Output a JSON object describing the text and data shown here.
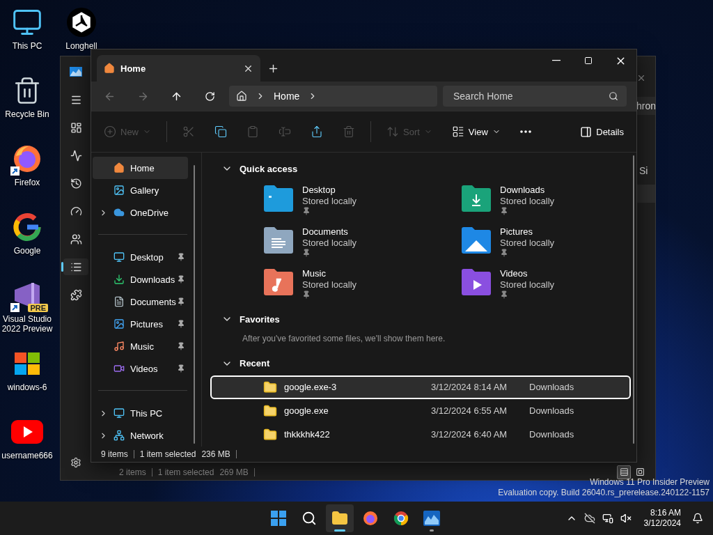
{
  "desktop_icons": [
    {
      "label": "This PC",
      "kind": "pc"
    },
    {
      "label": "Recycle Bin",
      "kind": "bin"
    },
    {
      "label": "Firefox",
      "kind": "firefox",
      "shortcut": true
    },
    {
      "label": "Google",
      "kind": "google"
    },
    {
      "label": "Visual Studio 2022 Preview",
      "kind": "vs",
      "shortcut": true,
      "badge": "PRE"
    },
    {
      "label": "windows-6",
      "kind": "windows"
    },
    {
      "label": "username666",
      "kind": "youtube"
    }
  ],
  "desktop_icons_column_2": [
    {
      "label": "Longhell",
      "kind": "unity"
    }
  ],
  "back_window": {
    "nav": [
      {
        "kind": "logo",
        "selected": false
      },
      {
        "kind": "menu",
        "selected": false
      },
      {
        "kind": "dashboard",
        "selected": false
      },
      {
        "kind": "pulse",
        "selected": false
      },
      {
        "kind": "history",
        "selected": false
      },
      {
        "kind": "gauge",
        "selected": false
      },
      {
        "kind": "people",
        "selected": false
      },
      {
        "kind": "list",
        "selected": true
      },
      {
        "kind": "puzzle",
        "selected": false
      }
    ],
    "title_fragment": "hron",
    "column_fragment": "Si",
    "status_bar": {
      "item_count": "2 items",
      "selection": "1 item selected",
      "size": "269 MB"
    },
    "view_buttons": [
      {
        "kind": "details",
        "selected": true
      },
      {
        "kind": "tiles",
        "selected": false
      }
    ]
  },
  "window": {
    "tabs": [
      {
        "label": "Home",
        "selected": true
      }
    ],
    "address": {
      "crumbs": [
        "Home"
      ]
    },
    "search": {
      "placeholder": "Search Home"
    },
    "toolbar": [
      {
        "kind": "new",
        "label": "New",
        "disabled": true,
        "dropdown": true
      },
      {
        "kind": "cut",
        "disabled": true
      },
      {
        "kind": "copy",
        "disabled": false
      },
      {
        "kind": "paste",
        "disabled": true
      },
      {
        "kind": "rename",
        "disabled": true
      },
      {
        "kind": "share",
        "disabled": false
      },
      {
        "kind": "delete",
        "disabled": true
      },
      {
        "kind": "sort",
        "label": "Sort",
        "disabled": true,
        "dropdown": true
      },
      {
        "kind": "view",
        "label": "View",
        "disabled": false,
        "dropdown": true
      },
      {
        "kind": "more",
        "disabled": false
      }
    ],
    "details_button": {
      "label": "Details"
    },
    "sidebar": {
      "groups": [
        [
          {
            "label": "Home",
            "kind": "home",
            "selected": true,
            "pinned": false,
            "expandable": false
          },
          {
            "label": "Gallery",
            "kind": "gallery",
            "selected": false,
            "pinned": false,
            "expandable": false
          },
          {
            "label": "OneDrive",
            "kind": "cloud",
            "selected": false,
            "pinned": false,
            "expandable": true
          }
        ],
        [
          {
            "label": "Desktop",
            "kind": "desktop",
            "selected": false,
            "pinned": true,
            "expandable": false
          },
          {
            "label": "Downloads",
            "kind": "downloads",
            "selected": false,
            "pinned": true,
            "expandable": false
          },
          {
            "label": "Documents",
            "kind": "documents",
            "selected": false,
            "pinned": true,
            "expandable": false
          },
          {
            "label": "Pictures",
            "kind": "pictures",
            "selected": false,
            "pinned": true,
            "expandable": false
          },
          {
            "label": "Music",
            "kind": "music",
            "selected": false,
            "pinned": true,
            "expandable": false
          },
          {
            "label": "Videos",
            "kind": "videos",
            "selected": false,
            "pinned": true,
            "expandable": false
          }
        ],
        [
          {
            "label": "This PC",
            "kind": "pc",
            "selected": false,
            "pinned": false,
            "expandable": true
          },
          {
            "label": "Network",
            "kind": "network",
            "selected": false,
            "pinned": false,
            "expandable": true
          }
        ]
      ]
    },
    "quick_access": {
      "title": "Quick access",
      "expanded": true,
      "folders": [
        {
          "name": "Desktop",
          "status": "Stored locally",
          "kind": "desktop",
          "pinned": true
        },
        {
          "name": "Downloads",
          "status": "Stored locally",
          "kind": "downloads",
          "pinned": true
        },
        {
          "name": "Documents",
          "status": "Stored locally",
          "kind": "documents",
          "pinned": true
        },
        {
          "name": "Pictures",
          "status": "Stored locally",
          "kind": "pictures",
          "pinned": true
        },
        {
          "name": "Music",
          "status": "Stored locally",
          "kind": "music",
          "pinned": true
        },
        {
          "name": "Videos",
          "status": "Stored locally",
          "kind": "videos",
          "pinned": true
        }
      ]
    },
    "favorites": {
      "title": "Favorites",
      "expanded": true,
      "message": "After you've favorited some files, we'll show them here."
    },
    "recent": {
      "title": "Recent",
      "expanded": true,
      "rows": [
        {
          "name": "google.exe-3",
          "date": "3/12/2024 8:14 AM",
          "location": "Downloads",
          "selected": true
        },
        {
          "name": "google.exe",
          "date": "3/12/2024 6:55 AM",
          "location": "Downloads",
          "selected": false
        },
        {
          "name": "thkkkhk422",
          "date": "3/12/2024 6:40 AM",
          "location": "Downloads",
          "selected": false
        }
      ]
    },
    "status_bar": {
      "item_count": "9 items",
      "selection": "1 item selected",
      "size": "236 MB"
    }
  },
  "watermark_os": {
    "line_1": "Windows 11 Pro Insider Preview",
    "line_2": "Evaluation copy. Build 26040.rs_prerelease.240122-1157"
  },
  "taskbar": {
    "apps": [
      {
        "kind": "start",
        "running": false,
        "active": false
      },
      {
        "kind": "search",
        "running": false,
        "active": false
      },
      {
        "kind": "explorer",
        "running": true,
        "active": true
      },
      {
        "kind": "firefox",
        "running": false,
        "active": false
      },
      {
        "kind": "chrome",
        "running": false,
        "active": false
      },
      {
        "kind": "devhome",
        "running": true,
        "active": false
      }
    ],
    "time": "8:16 AM",
    "date": "3/12/2024"
  }
}
